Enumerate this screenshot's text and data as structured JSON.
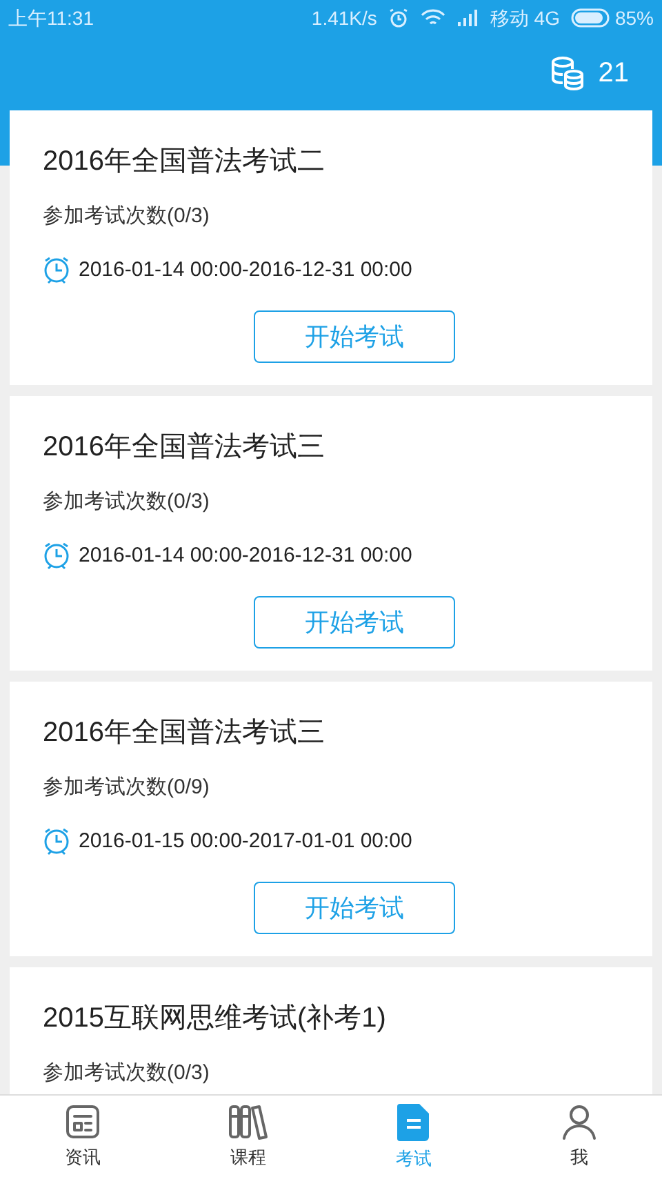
{
  "status_bar": {
    "time": "上午11:31",
    "speed": "1.41K/s",
    "carrier": "移动 4G",
    "battery": "85%"
  },
  "header": {
    "coins": "21"
  },
  "exams": [
    {
      "title": "2016年全国普法考试二",
      "attempts": "参加考试次数(0/3)",
      "period": "2016-01-14 00:00-2016-12-31 00:00",
      "button": "开始考试"
    },
    {
      "title": "2016年全国普法考试三",
      "attempts": "参加考试次数(0/3)",
      "period": "2016-01-14 00:00-2016-12-31 00:00",
      "button": "开始考试"
    },
    {
      "title": "2016年全国普法考试三",
      "attempts": "参加考试次数(0/9)",
      "period": "2016-01-15 00:00-2017-01-01 00:00",
      "button": "开始考试"
    },
    {
      "title": "2015互联网思维考试(补考1)",
      "attempts": "参加考试次数(0/3)"
    }
  ],
  "tabs": [
    {
      "kind": "news",
      "label": "资讯",
      "selected": false
    },
    {
      "kind": "courses",
      "label": "课程",
      "selected": false
    },
    {
      "kind": "exam",
      "label": "考试",
      "selected": true
    },
    {
      "kind": "me",
      "label": "我",
      "selected": false
    }
  ]
}
